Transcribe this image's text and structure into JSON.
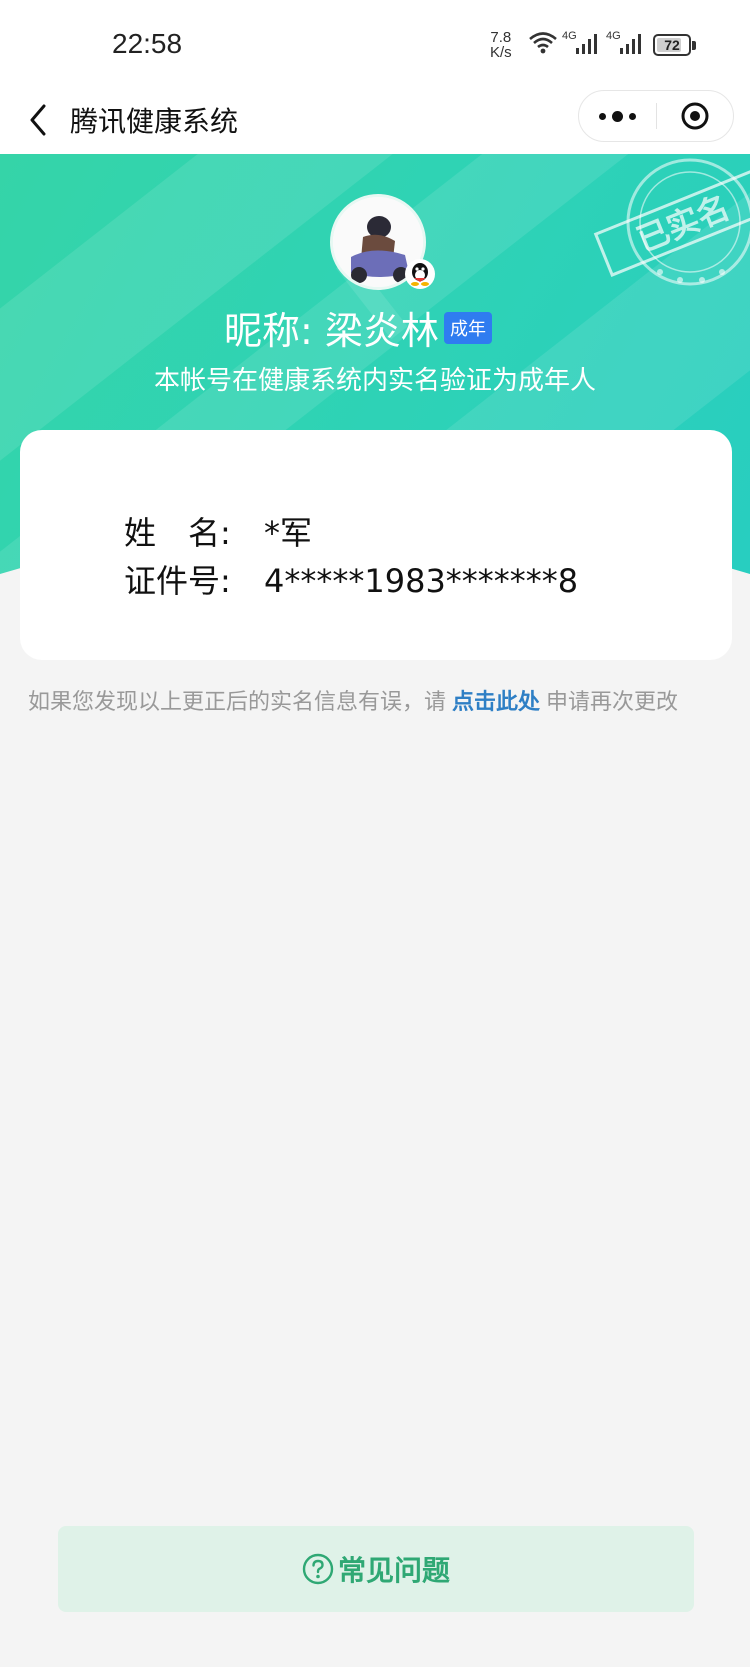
{
  "status_bar": {
    "time": "22:58",
    "net_speed_value": "7.8",
    "net_speed_unit": "K/s",
    "signal_1_label": "4G",
    "signal_2_label": "4G",
    "battery_level": "72",
    "icons": [
      "wifi-icon",
      "signal-icon",
      "battery-icon"
    ]
  },
  "nav": {
    "title": "腾讯健康系统",
    "back_icon": "chevron-left-icon",
    "more_icon": "more-dots-icon",
    "close_icon": "target-circle-icon"
  },
  "profile": {
    "nickname": "昵称: 梁炎林",
    "age_badge": "成年",
    "description": "本帐号在健康系统内实名验证为成年人",
    "stamp_text": "已实名",
    "avatar_icon": "avatar-image",
    "qq_icon": "qq-penguin-icon"
  },
  "info": {
    "name_label": "姓　名:",
    "name_value": "*军",
    "id_label": "证件号:",
    "id_value": "4*****1983*******8"
  },
  "note": {
    "prefix": "如果您发现以上更正后的实名信息有误，请",
    "link": "点击此处",
    "suffix": "申请再次更改"
  },
  "faq": {
    "label": "常见问题",
    "icon": "question-circle-icon"
  },
  "colors": {
    "hero_gradient_start": "#35d4a8",
    "hero_gradient_end": "#28cec0",
    "age_badge": "#2f7cf0",
    "link": "#2e7fc5",
    "faq_bg": "#dff2e8",
    "faq_text": "#2fa874"
  }
}
